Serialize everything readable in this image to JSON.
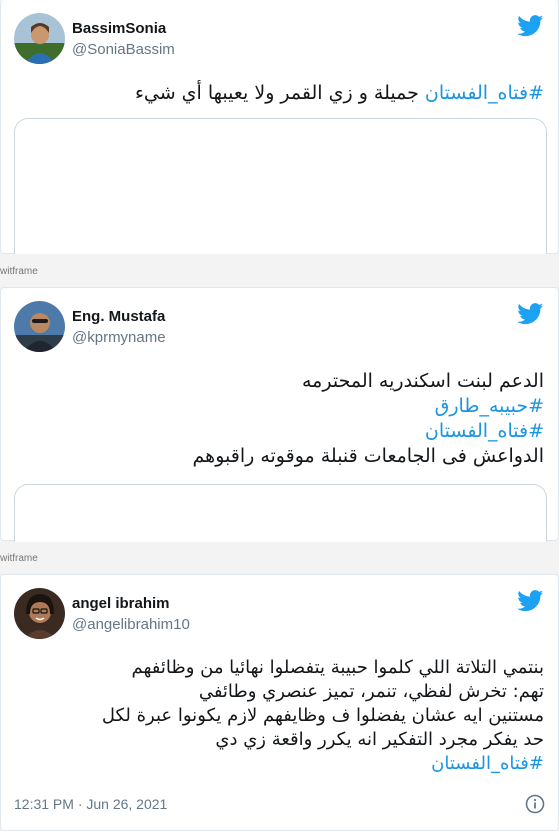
{
  "tweets": [
    {
      "display_name": "BassimSonia",
      "handle": "@SoniaBassim",
      "avatar": "profile-photo",
      "lines": [
        {
          "hashtag": "#فتاه_الفستان",
          "text": "  جميلة و زي القمر ولا يعيبها أي شيء"
        }
      ]
    },
    {
      "display_name": "Eng. Mustafa",
      "handle": "@kprmyname",
      "avatar": "profile-photo",
      "lines": [
        {
          "text": "الدعم لبنت اسكندريه المحترمه"
        },
        {
          "hashtag": "#حبيبه_طارق"
        },
        {
          "hashtag": "#فتاه_الفستان"
        },
        {
          "text": "الدواعش فى الجامعات قنبلة موقوته راقبوهم"
        }
      ]
    },
    {
      "display_name": "angel ibrahim",
      "handle": "@angelibrahim10",
      "avatar": "profile-photo",
      "lines": [
        {
          "text": "بنتمي التلاتة اللي كلموا حبيبة يتفصلوا نهائيا من وظائفهم"
        },
        {
          "text": "تهم: تخرش لفظي، تنمر، تميز عنصري وطائفي"
        },
        {
          "text": "مستنين ايه عشان يفضلوا ف وظايفهم لازم يكونوا عبرة لكل"
        },
        {
          "text": "حد يفكر مجرد التفكير انه يكرر واقعة زي دي"
        },
        {
          "hashtag": "#فتاه_الفستان"
        }
      ],
      "timestamp": "12:31 PM · Jun 26, 2021"
    }
  ],
  "frame_label": "witframe",
  "icons": {
    "brand": "twitter-bird-icon",
    "info": "info-icon"
  },
  "colors": {
    "brand": "#1da1f2",
    "hashtag": "#1b95e0",
    "text": "#14171a",
    "muted": "#657786"
  }
}
